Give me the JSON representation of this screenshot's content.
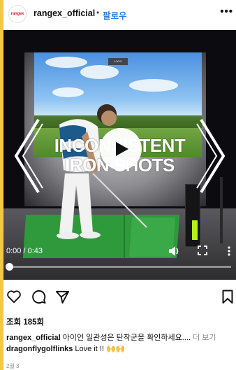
{
  "header": {
    "avatar_text": "rangex",
    "username": "rangex_official",
    "separator": "•",
    "follow_label": "팔로우",
    "more_label": "•••"
  },
  "video": {
    "overlay_line1": "INCONSISTENT",
    "overlay_line2": "IRON SHOTS",
    "screen_label": "LOGO",
    "time": "0:00 / 0:43",
    "progress": 0,
    "accent_mat": "#2f9a3c",
    "accent_device": "#b6f21a"
  },
  "actions": {
    "like_icon": "heart-icon",
    "comment_icon": "comment-icon",
    "share_icon": "send-icon",
    "save_icon": "bookmark-icon"
  },
  "stats": {
    "views": "조회 185회"
  },
  "caption": {
    "username": "rangex_official",
    "text": "아이언 일관성은 탄착군을 확인하세요....",
    "more": "더 보기"
  },
  "comment": {
    "username": "dragonflygolflinks",
    "text": "Love it !! 🙌🙌"
  },
  "date": "2월 3"
}
